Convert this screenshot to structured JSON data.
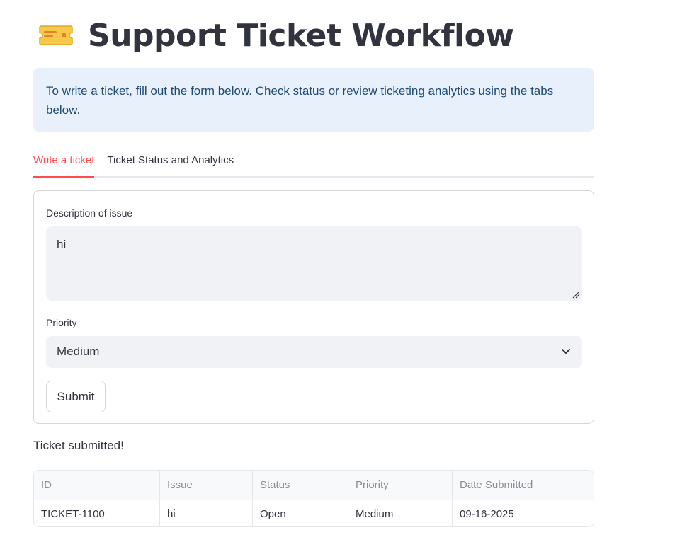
{
  "header": {
    "icon": "ticket-icon",
    "title": "Support Ticket Workflow"
  },
  "info": {
    "text": "To write a ticket, fill out the form below. Check status or review ticketing analytics using the tabs below."
  },
  "tabs": [
    {
      "label": "Write a ticket",
      "active": true
    },
    {
      "label": "Ticket Status and Analytics",
      "active": false
    }
  ],
  "form": {
    "description_label": "Description of issue",
    "description_value": "hi",
    "priority_label": "Priority",
    "priority_value": "Medium",
    "submit_label": "Submit"
  },
  "result": {
    "message": "Ticket submitted!"
  },
  "table": {
    "columns": [
      "ID",
      "Issue",
      "Status",
      "Priority",
      "Date Submitted"
    ],
    "rows": [
      [
        "TICKET-1100",
        "hi",
        "Open",
        "Medium",
        "09-16-2025"
      ]
    ]
  },
  "colors": {
    "accent": "#ff4b4b",
    "info_bg": "#e8f1fb",
    "info_text": "#1f4a74",
    "ticket_icon": "#f7c948"
  }
}
